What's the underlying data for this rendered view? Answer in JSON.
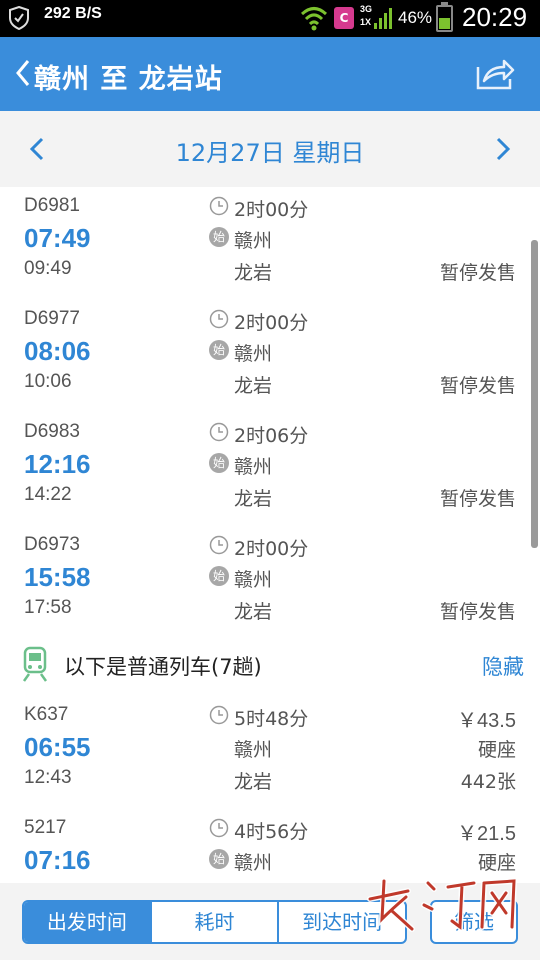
{
  "status_bar": {
    "net_speed": "292 B/S",
    "carrier_badge": "C",
    "net_type_top": "3G",
    "net_type_bottom": "1X",
    "battery_percent": "46%",
    "battery_level": 0.46,
    "time": "20:29"
  },
  "header": {
    "title": "赣州 至 龙岩站",
    "back_icon": "chevron-left-icon",
    "share_icon": "share-icon"
  },
  "date_nav": {
    "date_label": "12月27日 星期日"
  },
  "trains": [
    {
      "number": "D6981",
      "depart": "07:49",
      "arrive": "09:49",
      "duration": "2时00分",
      "start_badge": "始",
      "from": "赣州",
      "to": "龙岩",
      "right_1": "",
      "right_2": "",
      "right_3": "暂停发售"
    },
    {
      "number": "D6977",
      "depart": "08:06",
      "arrive": "10:06",
      "duration": "2时00分",
      "start_badge": "始",
      "from": "赣州",
      "to": "龙岩",
      "right_1": "",
      "right_2": "",
      "right_3": "暂停发售"
    },
    {
      "number": "D6983",
      "depart": "12:16",
      "arrive": "14:22",
      "duration": "2时06分",
      "start_badge": "始",
      "from": "赣州",
      "to": "龙岩",
      "right_1": "",
      "right_2": "",
      "right_3": "暂停发售"
    },
    {
      "number": "D6973",
      "depart": "15:58",
      "arrive": "17:58",
      "duration": "2时00分",
      "start_badge": "始",
      "from": "赣州",
      "to": "龙岩",
      "right_1": "",
      "right_2": "",
      "right_3": "暂停发售"
    }
  ],
  "regular_section": {
    "label": "以下是普通列车(7趟)",
    "hide_label": "隐藏"
  },
  "regular_trains": [
    {
      "number": "K637",
      "depart": "06:55",
      "arrive": "12:43",
      "duration": "5时48分",
      "start_badge": "",
      "from": "赣州",
      "to": "龙岩",
      "right_1": "￥43.5",
      "right_2": "硬座",
      "right_3": "442张"
    },
    {
      "number": "5217",
      "depart": "07:16",
      "arrive": "",
      "duration": "4时56分",
      "start_badge": "始",
      "from": "赣州",
      "to": "",
      "right_1": "￥21.5",
      "right_2": "硬座",
      "right_3": ""
    }
  ],
  "bottom_tabs": {
    "tabs": [
      "出发时间",
      "耗时",
      "到达时间"
    ],
    "active_index": 0,
    "filter_label": "筛选"
  },
  "watermark": {
    "text": "长江网"
  }
}
